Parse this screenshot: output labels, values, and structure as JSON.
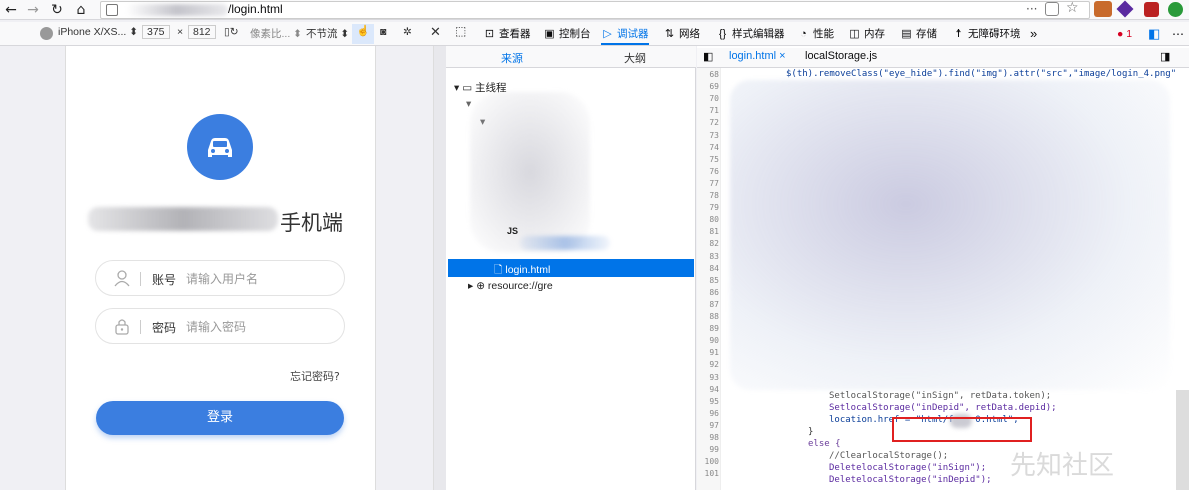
{
  "browser": {
    "url_suffix": "/login.html"
  },
  "rdm": {
    "device": "iPhone X/XS...",
    "width": "375",
    "times": "×",
    "height": "812",
    "dpr": "像素比...",
    "throttle": "不节流"
  },
  "devtools": {
    "tabs": [
      {
        "label": "查看器",
        "icon": "inspector-icon"
      },
      {
        "label": "控制台",
        "icon": "console-icon"
      },
      {
        "label": "调试器",
        "icon": "debugger-icon"
      },
      {
        "label": "网络",
        "icon": "network-icon"
      },
      {
        "label": "样式编辑器",
        "icon": "style-editor-icon"
      },
      {
        "label": "性能",
        "icon": "performance-icon"
      },
      {
        "label": "内存",
        "icon": "memory-icon"
      },
      {
        "label": "存储",
        "icon": "storage-icon"
      },
      {
        "label": "无障碍环境",
        "icon": "accessibility-icon"
      }
    ],
    "error_count": "1"
  },
  "app": {
    "title_suffix": "手机端",
    "account_label": "账号",
    "account_placeholder": "请输入用户名",
    "password_label": "密码",
    "password_placeholder": "请输入密码",
    "forgot": "忘记密码?",
    "login": "登录"
  },
  "sources": {
    "tab_sources": "来源",
    "tab_outline": "大纲",
    "main_thread": "主线程",
    "js_fragment": "JS",
    "selected_file": "login.html",
    "resource": "resource://gre"
  },
  "editor": {
    "tabs": [
      "login.html",
      "localStorage.js"
    ],
    "close": "×",
    "line_numbers": [
      "68",
      "69",
      "70",
      "71",
      "72",
      "73",
      "74",
      "75",
      "76",
      "77",
      "78",
      "79",
      "80",
      "81",
      "82",
      "83",
      "84",
      "85",
      "86",
      "87",
      "88",
      "89",
      "90",
      "91",
      "92",
      "93",
      "94",
      "95",
      "96",
      "97",
      "98",
      "99",
      "100",
      "101"
    ],
    "line68": "$(th).removeClass(\"eye_hide\").find(\"img\").attr(\"src\",\"image/login_4.png\"",
    "line94": "SetlocalStorage(\"inSign\", retData.token);",
    "line95": "SetlocalStorage(\"inDepid\", retData.depid);",
    "line96": "location.href = \"html/f    0.html\";",
    "line97": "}",
    "line98": "else {",
    "line99": "//ClearlocalStorage();",
    "line100": "DeletelocalStorage(\"inSign\");",
    "line101": "DeletelocalStorage(\"inDepid\");"
  },
  "watermark": "先知社区"
}
